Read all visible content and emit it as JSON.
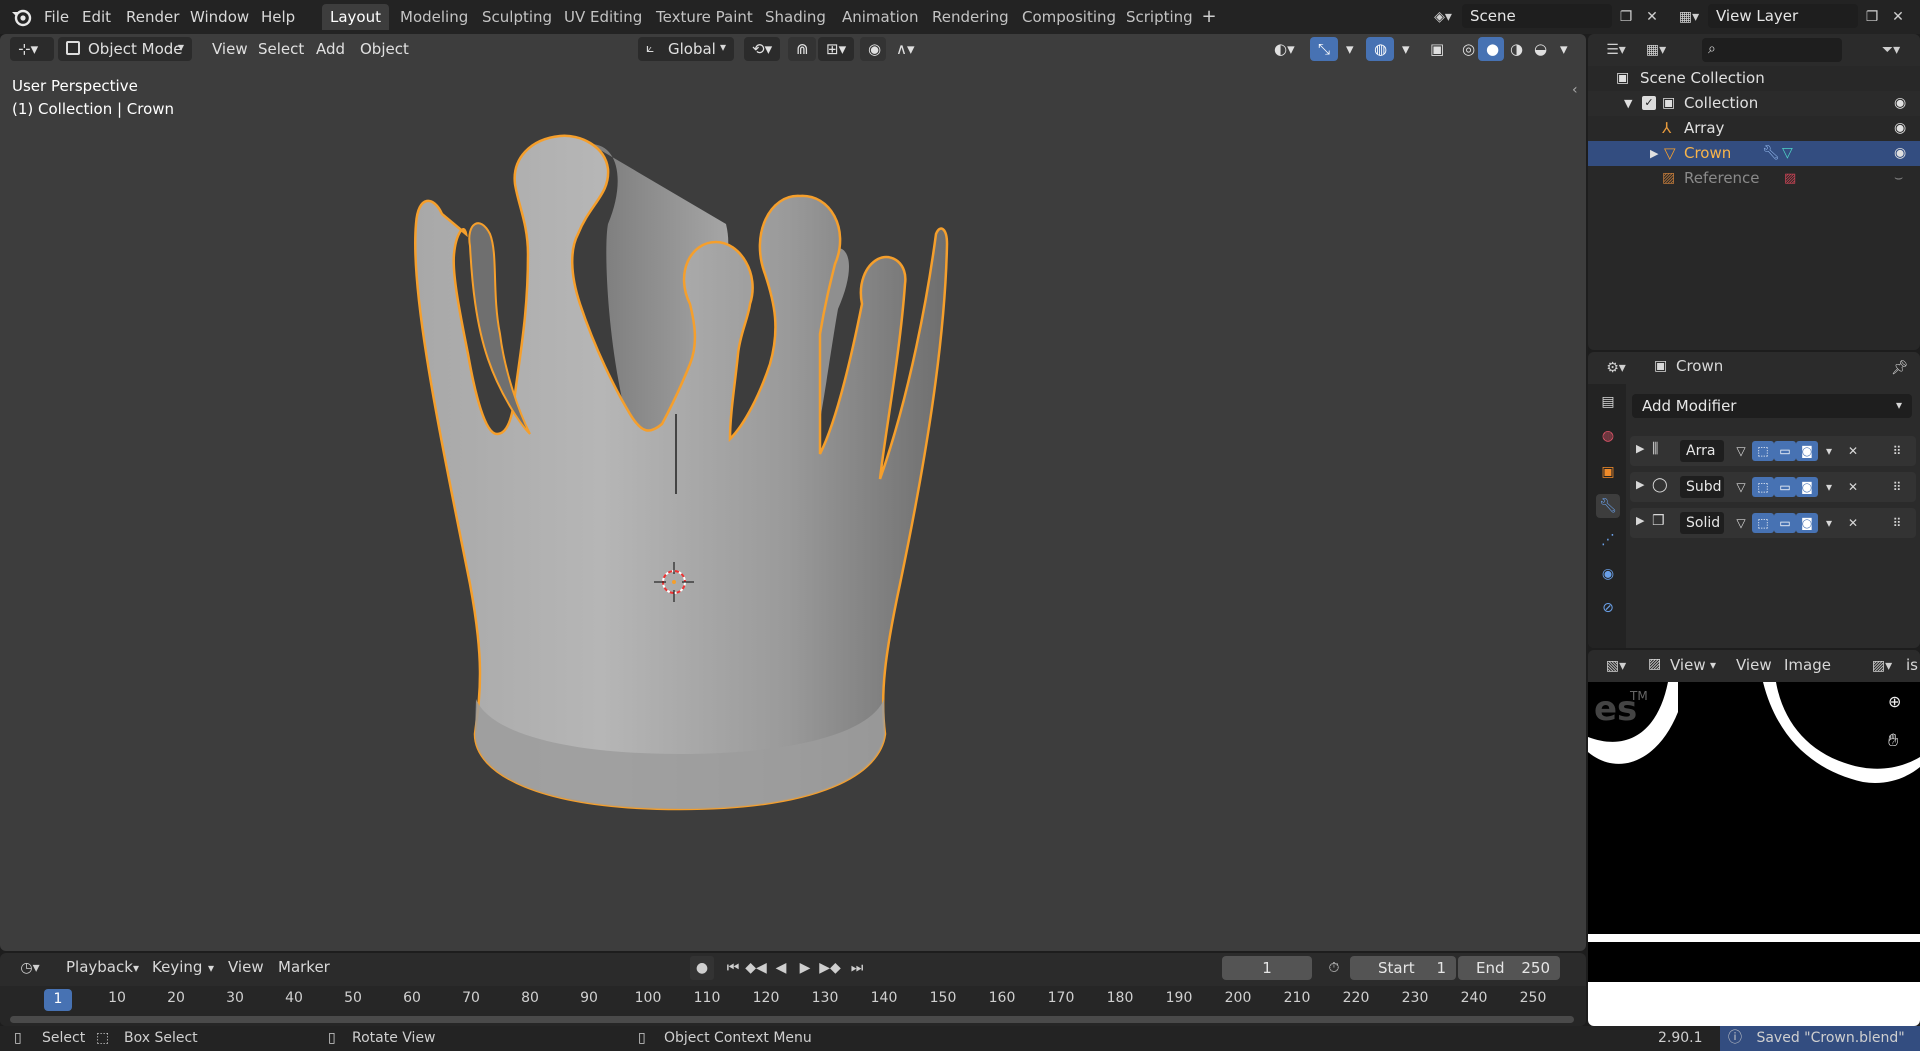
{
  "menu": [
    "File",
    "Edit",
    "Render",
    "Window",
    "Help"
  ],
  "workspaces": [
    "Layout",
    "Modeling",
    "Sculpting",
    "UV Editing",
    "Texture Paint",
    "Shading",
    "Animation",
    "Rendering",
    "Compositing",
    "Scripting"
  ],
  "active_workspace": "Layout",
  "scene": "Scene",
  "view_layer": "View Layer",
  "viewport": {
    "mode": "Object Mode",
    "menus": [
      "View",
      "Select",
      "Add",
      "Object"
    ],
    "transform_orientation": "Global",
    "perspective_label": "User Perspective",
    "collection_label": "(1) Collection | Crown"
  },
  "outliner": {
    "search_placeholder": "",
    "rows": [
      {
        "label": "Scene Collection"
      },
      {
        "label": "Collection"
      },
      {
        "label": "Array"
      },
      {
        "label": "Crown"
      },
      {
        "label": "Reference"
      }
    ]
  },
  "properties": {
    "object_name": "Crown",
    "add_modifier": "Add Modifier",
    "modifiers": [
      {
        "name": "Arra"
      },
      {
        "name": "Subd"
      },
      {
        "name": "Solid"
      }
    ]
  },
  "image_editor": {
    "menus": [
      "View",
      "View",
      "Image"
    ],
    "tab_fragment": "is"
  },
  "timeline": {
    "menus": [
      "Playback",
      "Keying",
      "View",
      "Marker"
    ],
    "current_frame": "1",
    "start_label": "Start",
    "start": "1",
    "end_label": "End",
    "end": "250",
    "ticks": [
      "1",
      "10",
      "20",
      "30",
      "40",
      "50",
      "60",
      "70",
      "80",
      "90",
      "100",
      "110",
      "120",
      "130",
      "140",
      "150",
      "160",
      "170",
      "180",
      "190",
      "200",
      "210",
      "220",
      "230",
      "240",
      "250"
    ]
  },
  "status": {
    "select": "Select",
    "box_select": "Box Select",
    "rotate_view": "Rotate View",
    "context_menu": "Object Context Menu",
    "version": "2.90.1",
    "saved": "Saved \"Crown.blend\""
  },
  "colors": {
    "selection_outline": "#f59f2c",
    "active_blue": "#4772b3",
    "viewport_bg": "#3d3d3d"
  }
}
